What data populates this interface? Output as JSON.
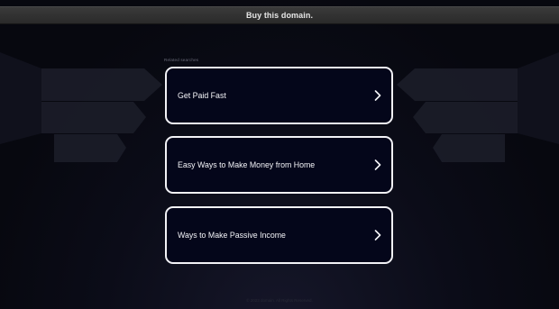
{
  "topbar": {
    "label": "Buy this domain."
  },
  "related": {
    "heading": "Related searches",
    "items": [
      {
        "label": "Get Paid Fast"
      },
      {
        "label": "Easy Ways to Make Money from Home"
      },
      {
        "label": "Ways to Make Passive Income"
      }
    ]
  },
  "footer": {
    "text": "© 2023 domain. All Rights Reserved."
  },
  "icons": {
    "chevron": "chevron-right-icon"
  },
  "colors": {
    "background": "#07080f",
    "card_border": "#f2f2f6",
    "card_fill": "#04061a",
    "topbar": "#333333"
  }
}
